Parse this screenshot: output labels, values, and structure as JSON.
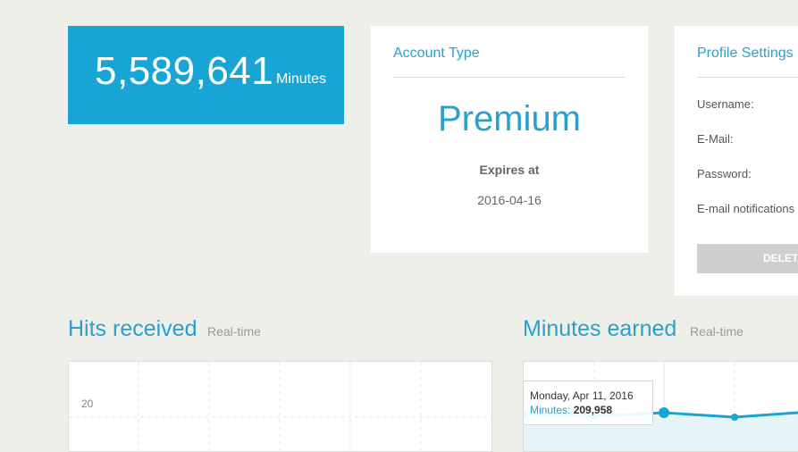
{
  "stats": {
    "minutes_value": "5,589,641",
    "minutes_unit": "Minutes"
  },
  "account": {
    "title": "Account Type",
    "type": "Premium",
    "expires_label": "Expires at",
    "expires_date": "2016-04-16"
  },
  "profile": {
    "title": "Profile Settings",
    "fields": [
      "Username:",
      "E-Mail:",
      "Password:",
      "E-mail notifications"
    ],
    "delete_label": "DELETE"
  },
  "hits": {
    "title": "Hits received",
    "subtitle": "Real-time",
    "y_tick": "20"
  },
  "minutes_earned": {
    "title": "Minutes earned",
    "subtitle": "Real-time",
    "tooltip": {
      "date": "Monday, Apr 11, 2016",
      "label": "Minutes:",
      "value": "209,958"
    }
  },
  "colors": {
    "accent": "#18a5d6",
    "title_blue": "#2b9fcd",
    "background": "#efefea"
  },
  "chart_data": [
    {
      "type": "line",
      "title": "Hits received",
      "y_ticks": [
        20
      ],
      "series": []
    },
    {
      "type": "area",
      "title": "Minutes earned",
      "x": [
        "Apr 11, 2016"
      ],
      "series": [
        {
          "name": "Minutes",
          "values": [
            209958
          ]
        }
      ]
    }
  ]
}
